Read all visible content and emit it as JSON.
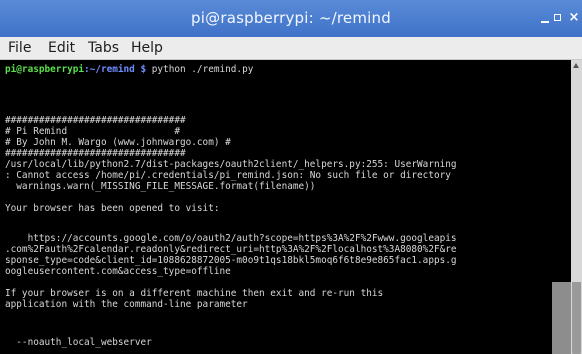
{
  "window": {
    "title": "pi@raspberrypi: ~/remind"
  },
  "menu": {
    "file": "File",
    "edit": "Edit",
    "tabs": "Tabs",
    "help": "Help"
  },
  "terminal": {
    "prompt_user": "pi@raspberrypi",
    "prompt_path": ":~/remind $ ",
    "prompt_command": "python ./remind.py",
    "lines": [
      "################################",
      "# Pi Remind                   #",
      "# By John M. Wargo (www.johnwargo.com) #",
      "################################",
      "/usr/local/lib/python2.7/dist-packages/oauth2client/_helpers.py:255: UserWarning",
      ": Cannot access /home/pi/.credentials/pi_remind.json: No such file or directory",
      "  warnings.warn(_MISSING_FILE_MESSAGE.format(filename))",
      "",
      "Your browser has been opened to visit:",
      "",
      "    https://accounts.google.com/o/oauth2/auth?scope=https%3A%2F%2Fwww.googleapis",
      ".com%2Fauth%2Fcalendar.readonly&redirect_uri=http%3A%2F%2Flocalhost%3A8080%2F&re",
      "sponse_type=code&client_id=1088628872005-m0o9t1qs18bkl5moq6f6t8e9e865fac1.apps.g",
      "oogleusercontent.com&access_type=offline",
      "",
      "If your browser is on a different machine then exit and re-run this",
      "application with the command-line parameter",
      "",
      "  --noauth_local_webserver"
    ]
  }
}
